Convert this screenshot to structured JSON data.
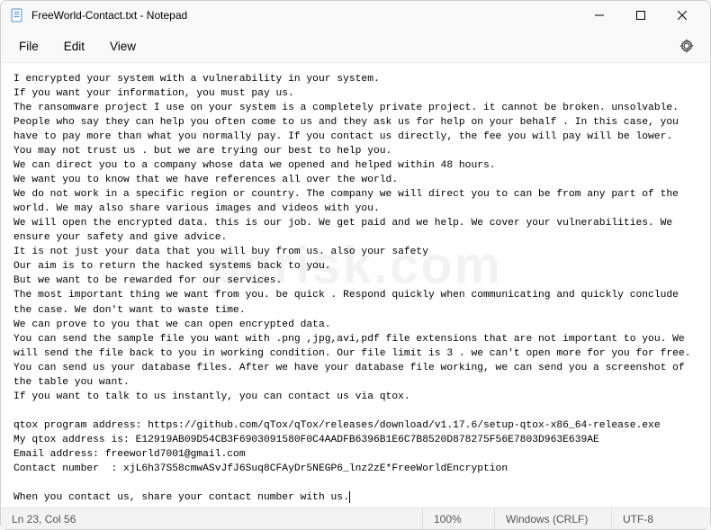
{
  "window": {
    "title": "FreeWorld-Contact.txt - Notepad"
  },
  "menu": {
    "file": "File",
    "edit": "Edit",
    "view": "View"
  },
  "content": {
    "text": "I encrypted your system with a vulnerability in your system.\nIf you want your information, you must pay us.\nThe ransomware project I use on your system is a completely private project. it cannot be broken. unsolvable.\nPeople who say they can help you often come to us and they ask us for help on your behalf . In this case, you have to pay more than what you normally pay. If you contact us directly, the fee you will pay will be lower.\nYou may not trust us . but we are trying our best to help you.\nWe can direct you to a company whose data we opened and helped within 48 hours.\nWe want you to know that we have references all over the world.\nWe do not work in a specific region or country. The company we will direct you to can be from any part of the world. We may also share various images and videos with you.\nWe will open the encrypted data. this is our job. We get paid and we help. We cover your vulnerabilities. We ensure your safety and give advice.\nIt is not just your data that you will buy from us. also your safety\nOur aim is to return the hacked systems back to you.\nBut we want to be rewarded for our services.\nThe most important thing we want from you. be quick . Respond quickly when communicating and quickly conclude the case. We don't want to waste time.\nWe can prove to you that we can open encrypted data.\nYou can send the sample file you want with .png ,jpg,avi,pdf file extensions that are not important to you. We will send the file back to you in working condition. Our file limit is 3 . we can't open more for you for free.\nYou can send us your database files. After we have your database file working, we can send you a screenshot of the table you want.\nIf you want to talk to us instantly, you can contact us via qtox.\n\nqtox program address: https://github.com/qTox/qTox/releases/download/v1.17.6/setup-qtox-x86_64-release.exe\nMy qtox address is: E12919AB09D54CB3F6903091580F0C4AADFB6396B1E6C7B8520D878275F56E7803D963E639AE\nEmail address: freeworld7001@gmail.com\nContact number  : xjL6h37S58cmwASvJfJ6Suq8CFAyDr5NEGP6_lnz2zE*FreeWorldEncryption\n\nWhen you contact us, share your contact number with us."
  },
  "status": {
    "position": "Ln 23, Col 56",
    "zoom": "100%",
    "eol": "Windows (CRLF)",
    "encoding": "UTF-8"
  },
  "watermark": "pcrisk.com"
}
